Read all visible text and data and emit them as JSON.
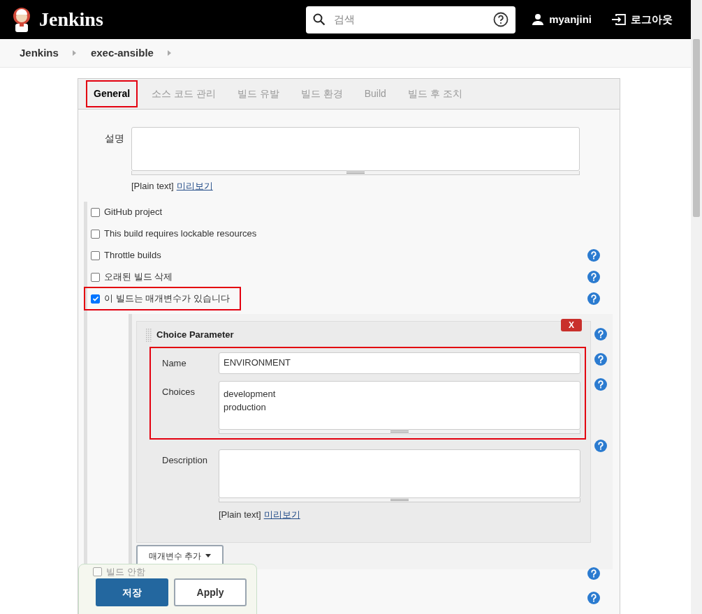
{
  "header": {
    "logo_text": "Jenkins",
    "search": {
      "placeholder": "검색"
    },
    "user": "myanjini",
    "logout": "로그아웃"
  },
  "breadcrumbs": [
    "Jenkins",
    "exec-ansible"
  ],
  "tabs": [
    {
      "label": "General",
      "selected": true,
      "highlighted": true
    },
    {
      "label": "소스 코드 관리",
      "selected": false,
      "highlighted": false
    },
    {
      "label": "빌드 유발",
      "selected": false,
      "highlighted": false
    },
    {
      "label": "빌드 환경",
      "selected": false,
      "highlighted": false
    },
    {
      "label": "Build",
      "selected": false,
      "highlighted": false
    },
    {
      "label": "빌드 후 조치",
      "selected": false,
      "highlighted": false
    }
  ],
  "description": {
    "label": "설명",
    "format": "[Plain text]",
    "preview": "미리보기"
  },
  "options": [
    {
      "label": "GitHub project",
      "checked": false,
      "help": false,
      "highlighted": false
    },
    {
      "label": "This build requires lockable resources",
      "checked": false,
      "help": false,
      "highlighted": false
    },
    {
      "label": "Throttle builds",
      "checked": false,
      "help": true,
      "highlighted": false
    },
    {
      "label": "오래된 빌드 삭제",
      "checked": false,
      "help": true,
      "highlighted": false
    },
    {
      "label": "이 빌드는 매개변수가 있습니다",
      "checked": true,
      "help": true,
      "highlighted": true
    }
  ],
  "parameter": {
    "title": "Choice Parameter",
    "delete": "X",
    "fields": [
      {
        "kind": "input",
        "label": "Name",
        "value": "ENVIRONMENT",
        "highlighted": true
      },
      {
        "kind": "textarea",
        "label": "Choices",
        "lines": [
          "development",
          "production"
        ],
        "highlighted": true
      },
      {
        "kind": "textarea",
        "label": "Description",
        "highlighted": false
      }
    ],
    "format": "[Plain text]",
    "preview": "미리보기"
  },
  "add_parameter": "매개변수 추가",
  "more_options": [
    {
      "label": "빌드 안함",
      "checked": false,
      "help": true
    },
    {
      "help": true
    }
  ],
  "footer": {
    "save": "저장",
    "apply": "Apply"
  }
}
